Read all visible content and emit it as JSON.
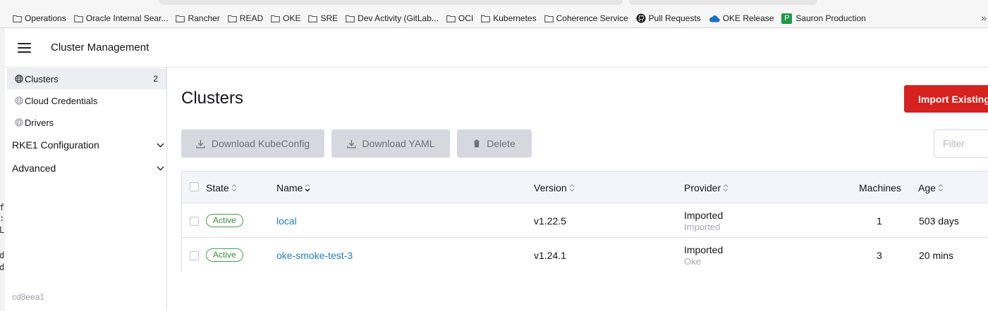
{
  "bookmarks": [
    {
      "label": "Operations",
      "icon": "folder-icon"
    },
    {
      "label": "Oracle Internal Sear...",
      "icon": "folder-icon"
    },
    {
      "label": "Rancher",
      "icon": "folder-icon"
    },
    {
      "label": "READ",
      "icon": "folder-icon"
    },
    {
      "label": "OKE",
      "icon": "folder-icon"
    },
    {
      "label": "SRE",
      "icon": "folder-icon"
    },
    {
      "label": "Dev Activity (GitLab...",
      "icon": "folder-icon"
    },
    {
      "label": "OCI",
      "icon": "folder-icon"
    },
    {
      "label": "Kubernetes",
      "icon": "folder-icon"
    },
    {
      "label": "Coherence Service",
      "icon": "folder-icon"
    },
    {
      "label": "Pull Requests",
      "icon": "github-icon"
    },
    {
      "label": "OKE Release",
      "icon": "cloud-icon"
    },
    {
      "label": "Sauron Production",
      "icon": "p-badge-icon",
      "badge": "P"
    }
  ],
  "bookmarks_more": "»",
  "edge_chars": [
    "f",
    ":",
    "L",
    "d",
    "d"
  ],
  "header": {
    "title": "Cluster Management"
  },
  "sidebar": {
    "items": [
      {
        "label": "Clusters",
        "count": "2",
        "icon": "globe-icon",
        "active": true
      },
      {
        "label": "Cloud Credentials",
        "icon": "globe-icon"
      },
      {
        "label": "Drivers",
        "icon": "globe-icon"
      }
    ],
    "groups": [
      {
        "label": "RKE1 Configuration",
        "icon": "chevron-down-icon"
      },
      {
        "label": "Advanced",
        "icon": "chevron-down-icon"
      }
    ],
    "version": "cd8eea1"
  },
  "main": {
    "title": "Clusters",
    "import_label": "Import Existing",
    "actions": [
      {
        "label": "Download KubeConfig",
        "icon": "download-icon"
      },
      {
        "label": "Download YAML",
        "icon": "download-icon"
      },
      {
        "label": "Delete",
        "icon": "trash-icon"
      }
    ],
    "filter_placeholder": "Filter"
  },
  "table": {
    "headers": {
      "state": "State",
      "name": "Name",
      "version": "Version",
      "provider": "Provider",
      "machines": "Machines",
      "age": "Age"
    },
    "rows": [
      {
        "state": "Active",
        "name": "local",
        "version": "v1.22.5",
        "provider": "Imported",
        "provider_sub": "Imported",
        "machines": "1",
        "age": "503 days"
      },
      {
        "state": "Active",
        "name": "oke-smoke-test-3",
        "version": "v1.24.1",
        "provider": "Imported",
        "provider_sub": "Oke",
        "machines": "3",
        "age": "20 mins"
      }
    ]
  },
  "colors": {
    "primary": "#d6211e",
    "link": "#1f7ec1",
    "active_badge": "#3b8a40"
  }
}
